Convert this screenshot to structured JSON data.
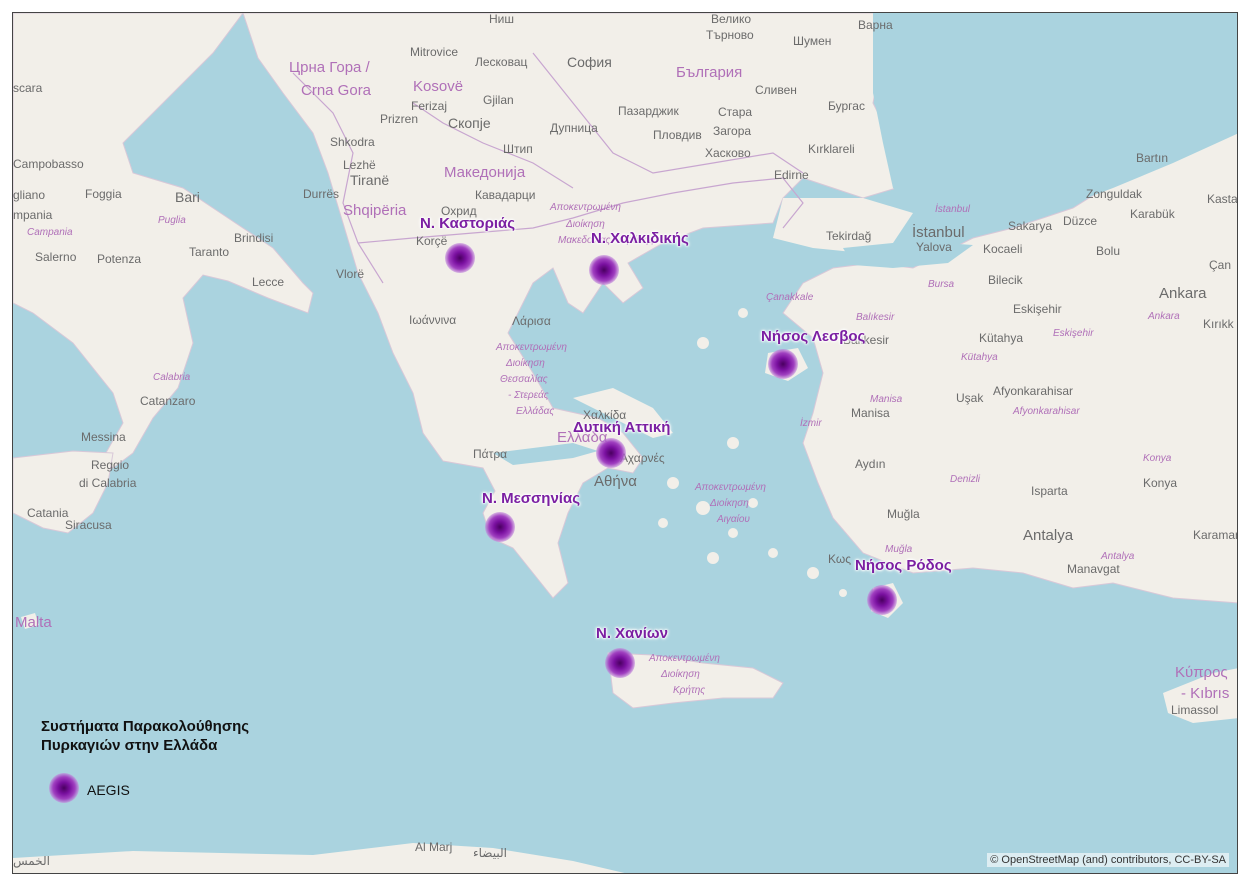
{
  "map": {
    "colors": {
      "sea": "#aad3df",
      "land": "#f2efe9",
      "border": "#c8a6d0",
      "site_label": "#7b1fa2",
      "site_marker": "#7a10a0"
    }
  },
  "legend": {
    "title_line1": "Συστήματα Παρακολούθησης",
    "title_line2": "Πυρκαγιών στην Ελλάδα",
    "items": [
      {
        "label": "AEGIS",
        "icon": "purple-dot-icon"
      }
    ]
  },
  "sites": [
    {
      "name": "Ν. Καστοριάς"
    },
    {
      "name": "Ν. Χαλκιδικής"
    },
    {
      "name": "Νήσος Λεσβος"
    },
    {
      "name": "Δυτική Αττική"
    },
    {
      "name": "Ν. Μεσσηνίας"
    },
    {
      "name": "Νήσος Ρόδος"
    },
    {
      "name": "Ν. Χανίων"
    }
  ],
  "basemap_labels": {
    "nis": "Ниш",
    "veliko": "Велико",
    "tarnovo": "Търново",
    "varna": "Варна",
    "shumen": "Шумен",
    "mitrovice": "Mitrovice",
    "leskovac": "Лесковац",
    "sofia": "София",
    "bulgaria": "България",
    "crna_gora_cyr": "Црна Гора /",
    "crna_gora_lat": "Crna Gora",
    "kosove": "Kosovë",
    "ferizaj": "Ferizaj",
    "gjilan": "Gjilan",
    "sliven": "Сливен",
    "burgas": "Бургас",
    "scara": "scara",
    "prizren": "Prizren",
    "skopje": "Скопје",
    "dupnitsa": "Дупница",
    "pazardzhik": "Пазарджик",
    "stara": "Стара",
    "zagora": "Загора",
    "plovdiv": "Пловдив",
    "shkodra": "Shkodra",
    "shtip": "Штип",
    "haskovo": "Хасково",
    "kirklareli": "Kırklareli",
    "campobasso": "Campobasso",
    "lezhe": "Lezhë",
    "tirane": "Tiranë",
    "makedonija": "Македонија",
    "edirne": "Edirne",
    "bartin": "Bartın",
    "gliano": "gliano",
    "foggia": "Foggia",
    "bari": "Bari",
    "durres": "Durrës",
    "kavadarci": "Кавадарци",
    "zonguldak": "Zonguldak",
    "kasta": "Kasta",
    "mpania": "mpania",
    "puglia": "Puglia",
    "shqiperia": "Shqipëria",
    "ohrid": "Охрид",
    "istanbul_reg": "İstanbul",
    "sakarya": "Sakarya",
    "duzce": "Düzce",
    "karabuk": "Karabük",
    "campania": "Campania",
    "brindisi": "Brindisi",
    "korce": "Korçë",
    "tekirdag": "Tekirdağ",
    "istanbul": "İstanbul",
    "yalova": "Yalova",
    "kocaeli": "Kocaeli",
    "bolu": "Bolu",
    "salerno": "Salerno",
    "potenza": "Potenza",
    "taranto": "Taranto",
    "bursa": "Bursa",
    "bilecik": "Bilecik",
    "can": "Çan",
    "lecce": "Lecce",
    "vlore": "Vlorë",
    "canakkale": "Çanakkale",
    "ankara": "Ankara",
    "eskisehir": "Eskişehir",
    "kirikk": "Kırıkk",
    "ioannina": "Ιωάννινα",
    "larisa": "Λάρισα",
    "balikesir_reg": "Balıkesir",
    "balikesir": "Balıkesir",
    "kutahya": "Kütahya",
    "eskisehir_reg": "Eskişehir",
    "ankara_reg": "Ankara",
    "kutahya_reg": "Kütahya",
    "calabria": "Calabria",
    "afyonkarahisar": "Afyonkarahisar",
    "usak": "Uşak",
    "catanzaro": "Catanzaro",
    "manisa_reg": "Manisa",
    "manisa": "Manisa",
    "afyon_reg": "Afyonkarahisar",
    "izmir": "İzmir",
    "chalkida": "Χαλκίδα",
    "messina": "Messina",
    "ellada": "Ελλάδα",
    "reggio": "Reggio",
    "di_calabria": "di Calabria",
    "patra": "Πάτρα",
    "acharnes": "Αχαρνές",
    "aydin": "Aydın",
    "konya_reg": "Konya",
    "athina": "Αθήνα",
    "denizli": "Denizli",
    "isparta": "Isparta",
    "konya": "Konya",
    "catania": "Catania",
    "siracusa": "Siracusa",
    "mugla": "Muğla",
    "antalya": "Antalya",
    "karaman": "Karaman",
    "kos": "Κως",
    "mugla_reg": "Muğla",
    "antalya_reg": "Antalya",
    "manavgat": "Manavgat",
    "malta": "Malta",
    "kypros": "Κύπρος",
    "kibris": "- Kıbrıs",
    "limassol": "Limassol",
    "al_marj": "Al Marj",
    "al_bayda": "البيضاء",
    "al_khums": "الخمس",
    "apok_mak": "Αποκεντρωμένη",
    "dioik_mak": "Διοίκηση",
    "mak_thr": "Μακεδονίας - Θράκης",
    "apok_thes": "Αποκεντρωμένη",
    "dioik_thes": "Διοίκηση",
    "thessalias": "Θεσσαλίας",
    "stereas": "- Στερεάς",
    "elladas": "Ελλάδας",
    "apok_aig": "Αποκεντρωμένη",
    "dioik_aig": "Διοίκηση",
    "aigaiou": "Αιγαίου",
    "apok_kri": "Αποκεντρωμένη",
    "dioik_kri": "Διοίκηση",
    "kritis": "Κρήτης"
  },
  "attribution": "© OpenStreetMap (and) contributors, CC-BY-SA"
}
